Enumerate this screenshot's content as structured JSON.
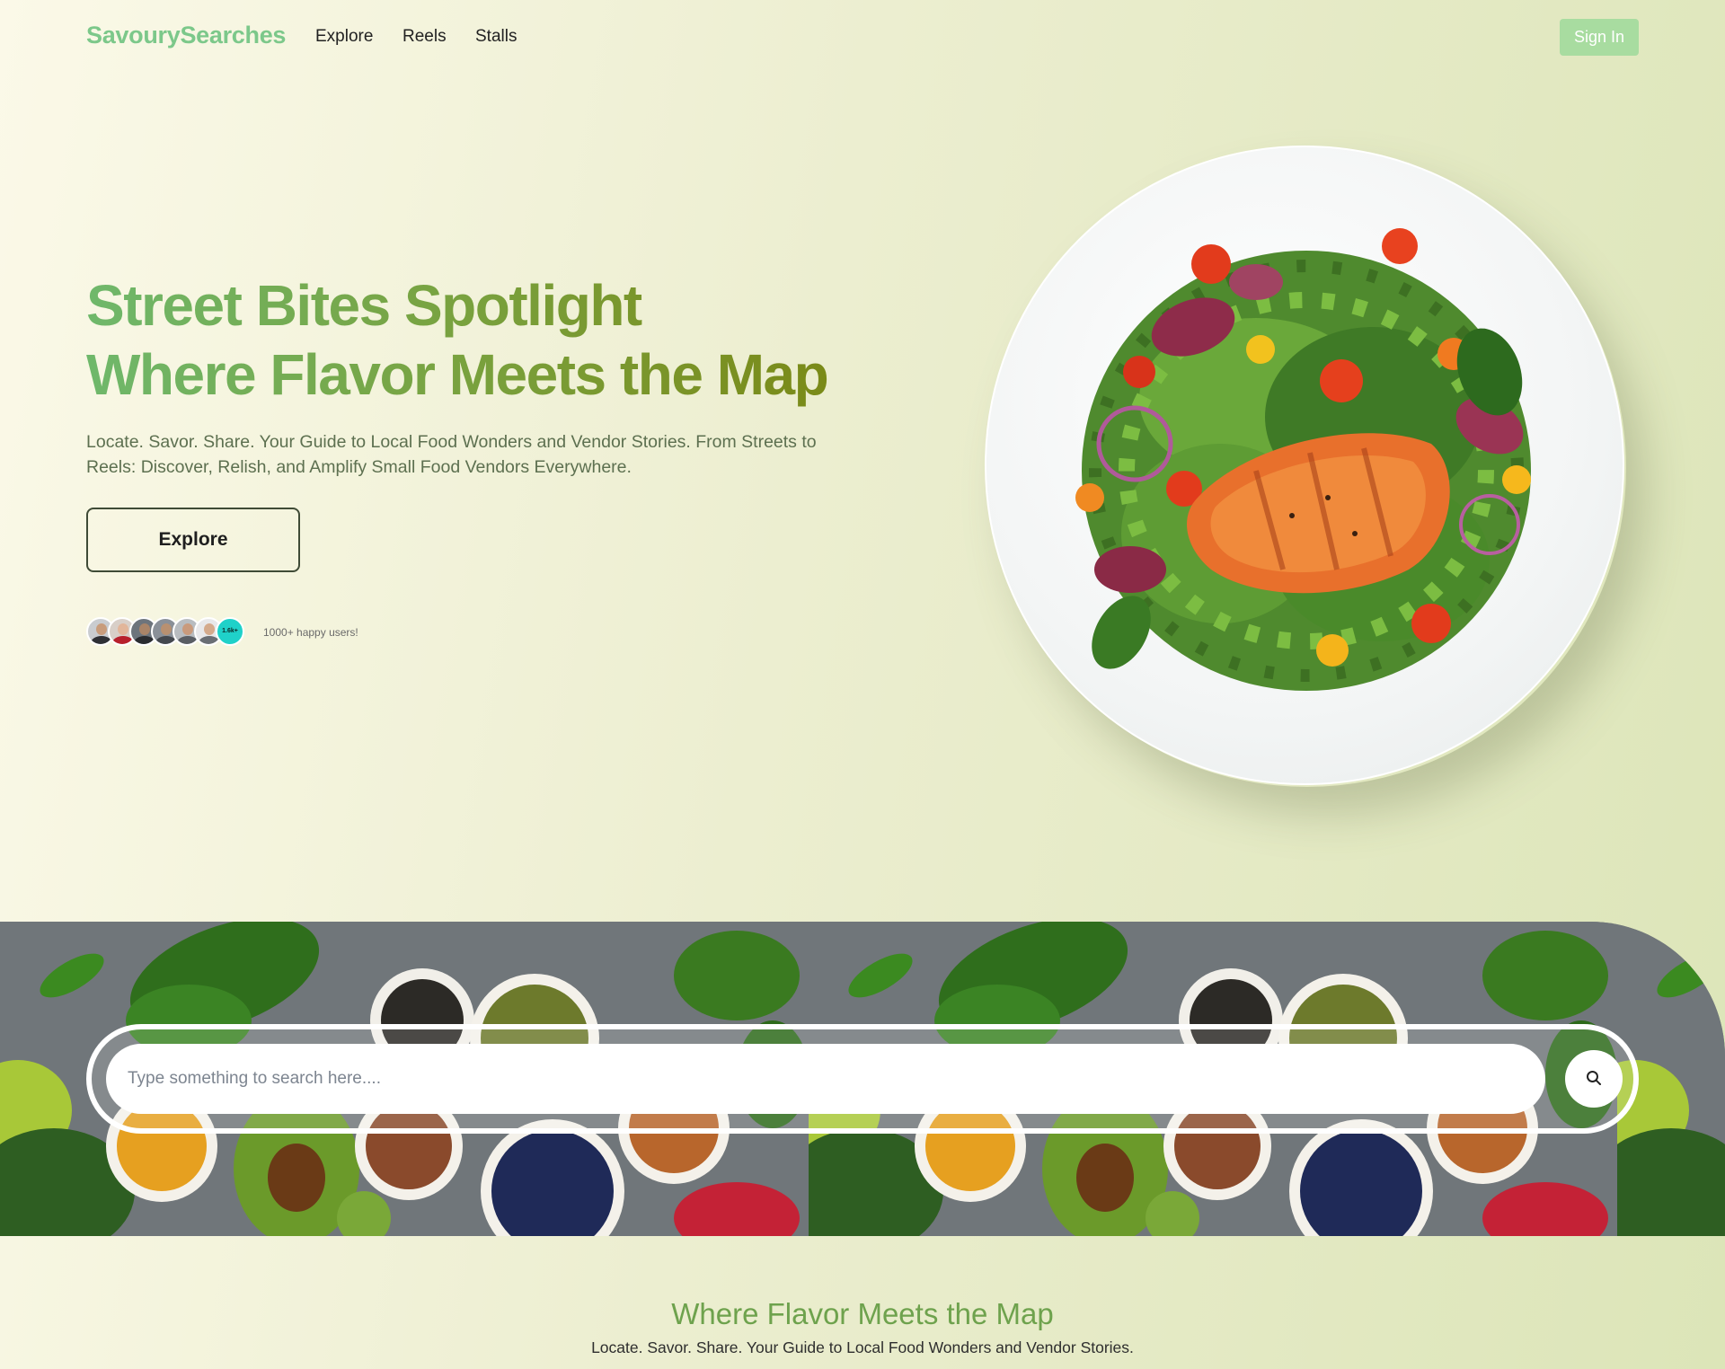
{
  "nav": {
    "logo": "SavourySearches",
    "links": [
      "Explore",
      "Reels",
      "Stalls"
    ],
    "signin_label": "Sign In"
  },
  "hero": {
    "title_line1": "Street Bites Spotlight",
    "title_line2": "Where Flavor Meets the Map",
    "subtitle": "Locate. Savor. Share. Your Guide to Local Food Wonders and Vendor Stories. From Streets to Reels: Discover, Relish, and Amplify Small Food Vendors Everywhere.",
    "explore_label": "Explore",
    "avatar_badge": "1.6k+",
    "happy_users": "1000+ happy users!"
  },
  "search": {
    "placeholder": "Type something to search here....",
    "button_icon": "search-icon"
  },
  "bottom": {
    "title": "Where Flavor Meets the Map",
    "subtitle": "Locate. Savor. Share. Your Guide to Local Food Wonders and Vendor Stories."
  },
  "colors": {
    "logo": "#7cc88a",
    "signin_bg": "#a8dca0",
    "title_gradient_start": "#6fb86b",
    "title_gradient_end": "#7a8a18",
    "badge": "#1fd1c9"
  }
}
